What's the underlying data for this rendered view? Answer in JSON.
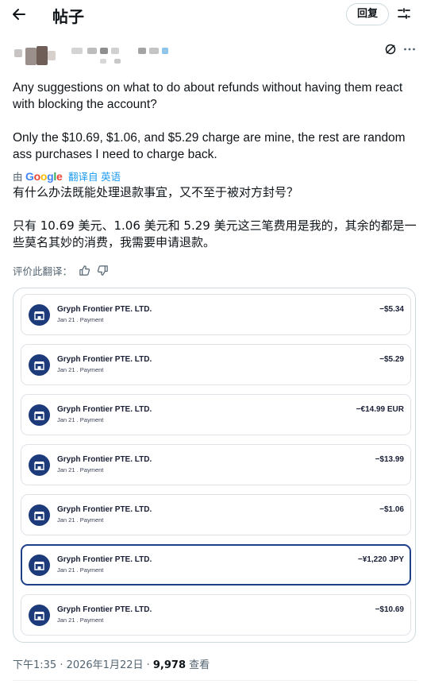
{
  "header": {
    "title": "帖子",
    "reply_label": "回复"
  },
  "post": {
    "text_en": [
      "Any suggestions on what to do about refunds without having them react with blocking the account?",
      "Only the $10.69, $1.06, and $5.29 charge are mine, the rest are random ass purchases I need to charge back."
    ],
    "translation": {
      "by": "由",
      "brand": "Google",
      "action": "翻译自 英语"
    },
    "text_cn": [
      "有什么办法既能处理退款事宜，又不至于被对方封号？",
      "只有 10.69 美元、1.06 美元和 5.29 美元这三笔费用是我的，其余的都是一些莫名其妙的消费，我需要申请退款。"
    ],
    "rate_label": "评价此翻译："
  },
  "transactions": [
    {
      "merchant": "Gryph Frontier PTE. LTD.",
      "sub": "Jan 21 . Payment",
      "amount": "−$5.34",
      "selected": false
    },
    {
      "merchant": "Gryph Frontier PTE. LTD.",
      "sub": "Jan 21 . Payment",
      "amount": "−$5.29",
      "selected": false
    },
    {
      "merchant": "Gryph Frontier PTE. LTD.",
      "sub": "Jan 21 . Payment",
      "amount": "−€14.99 EUR",
      "selected": false
    },
    {
      "merchant": "Gryph Frontier PTE. LTD.",
      "sub": "Jan 21 . Payment",
      "amount": "−$13.99",
      "selected": false
    },
    {
      "merchant": "Gryph Frontier PTE. LTD.",
      "sub": "Jan 21 . Payment",
      "amount": "−$1.06",
      "selected": false
    },
    {
      "merchant": "Gryph Frontier PTE. LTD.",
      "sub": "Jan 21 . Payment",
      "amount": "−¥1,220 JPY",
      "selected": true
    },
    {
      "merchant": "Gryph Frontier PTE. LTD.",
      "sub": "Jan 21 . Payment",
      "amount": "−$10.69",
      "selected": false
    }
  ],
  "meta": {
    "time": "下午1:35 · 2026年1月22日 · ",
    "views": "9,978",
    "views_label": " 查看"
  },
  "icons": {
    "back": "arrow-left-icon",
    "filter": "sliders-icon",
    "grok": "grok-icon",
    "more": "more-icon",
    "thumb_up": "thumbs-up-icon",
    "thumb_down": "thumbs-down-icon",
    "store": "storefront-icon"
  },
  "colors": {
    "accent": "#1d9bf0",
    "merchant_icon": "#1d3a7a",
    "selected_border": "#1e3f8a"
  }
}
